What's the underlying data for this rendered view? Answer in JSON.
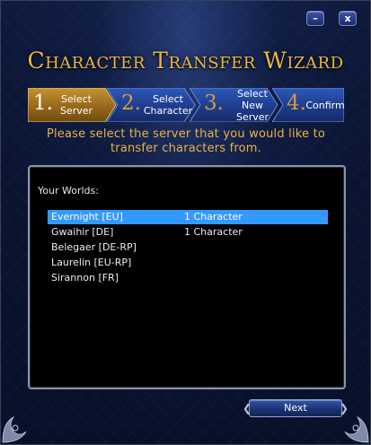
{
  "window": {
    "minimize_label": "–",
    "close_label": "x",
    "title": "Character Transfer Wizard"
  },
  "steps": [
    {
      "number": "1.",
      "label": "Select Server",
      "active": true
    },
    {
      "number": "2.",
      "label": "Select Character",
      "active": false
    },
    {
      "number": "3.",
      "label": "Select New Server",
      "active": false
    },
    {
      "number": "4.",
      "label": "Confirm",
      "active": false
    }
  ],
  "instruction": "Please select the server that you would like to transfer characters from.",
  "worlds": {
    "heading": "Your Worlds:",
    "rows": [
      {
        "server": "Evernight [EU]",
        "characters": "1 Character",
        "selected": true
      },
      {
        "server": "Gwaihir [DE]",
        "characters": "1 Character",
        "selected": false
      },
      {
        "server": "Belegaer [DE-RP]",
        "characters": "",
        "selected": false
      },
      {
        "server": "Laurelin [EU-RP]",
        "characters": "",
        "selected": false
      },
      {
        "server": "Sirannon [FR]",
        "characters": "",
        "selected": false
      }
    ]
  },
  "footer": {
    "next_label": "Next"
  },
  "colors": {
    "accent_gold": "#e8b64a",
    "active_step": "#9c6c1c",
    "inactive_step": "#1f3f90",
    "selection": "#3399ff"
  }
}
